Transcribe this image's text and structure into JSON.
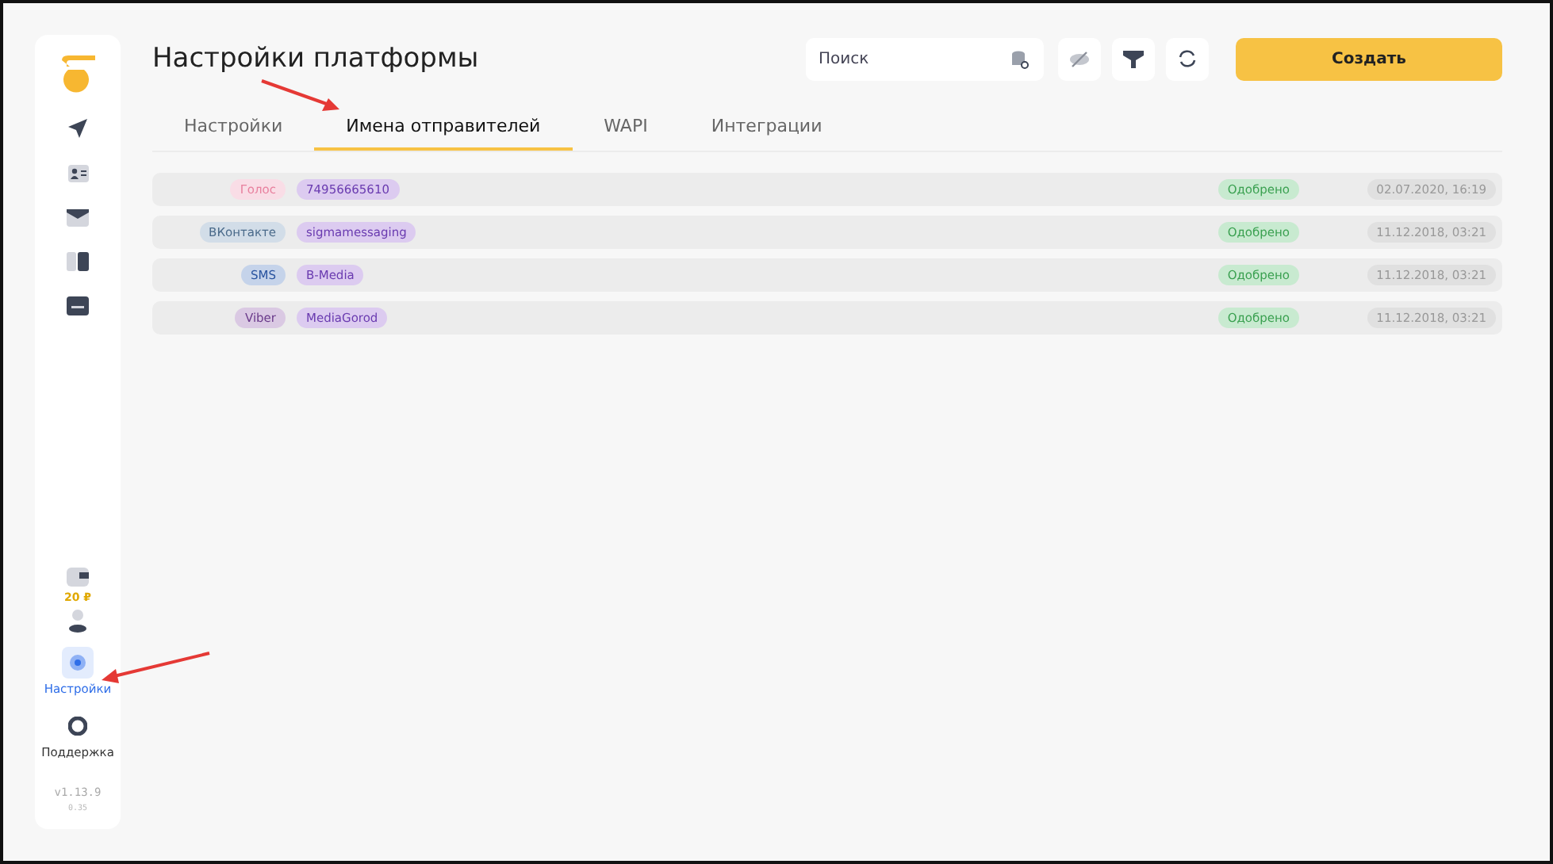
{
  "header": {
    "title": "Настройки платформы",
    "search": {
      "placeholder": "Поиск"
    },
    "create_button": "Создать"
  },
  "tabs": [
    {
      "label": "Настройки",
      "selected": false
    },
    {
      "label": "Имена отправителей",
      "selected": true
    },
    {
      "label": "WAPI",
      "selected": false
    },
    {
      "label": "Интеграции",
      "selected": false
    }
  ],
  "sidebar": {
    "balance": "20 ₽",
    "items": [
      {
        "kind": "settings",
        "label": "Настройки",
        "selected": true
      },
      {
        "kind": "support",
        "label": "Поддержка",
        "selected": false
      }
    ],
    "version": "v1.13.9",
    "build": "0.35"
  },
  "senders": [
    {
      "channel": "Голос",
      "kind": "voice",
      "name": "74956665610",
      "status": "Одобрено",
      "date": "02.07.2020, 16:19"
    },
    {
      "channel": "ВКонтакте",
      "kind": "vk",
      "name": "sigmamessaging",
      "status": "Одобрено",
      "date": "11.12.2018, 03:21"
    },
    {
      "channel": "SMS",
      "kind": "sms",
      "name": "B-Media",
      "status": "Одобрено",
      "date": "11.12.2018, 03:21"
    },
    {
      "channel": "Viber",
      "kind": "viber",
      "name": "MediaGorod",
      "status": "Одобрено",
      "date": "11.12.2018, 03:21"
    }
  ]
}
